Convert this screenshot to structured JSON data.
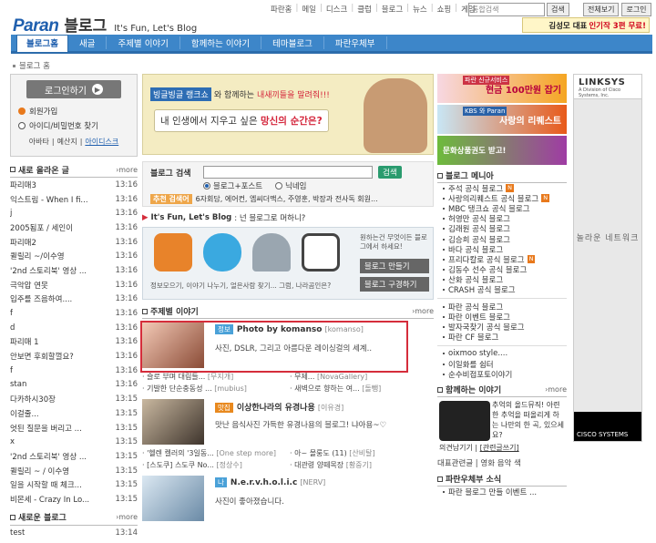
{
  "top_links": [
    "파란홈",
    "메일",
    "디스크",
    "클럽",
    "블로그",
    "뉴스",
    "쇼핑",
    "게임"
  ],
  "search_placeholder": "통합검색",
  "search_button": "검색",
  "util_links": [
    "전체보기",
    "로그인"
  ],
  "logo": {
    "brand": "Paran",
    "title": "블로그",
    "slogan": "It's Fun, Let's Blog"
  },
  "top_banner": {
    "text": "김성모 대표",
    "highlight": "인기작 3편 무료!"
  },
  "main_nav": [
    {
      "label": "블로그홈",
      "active": true
    },
    {
      "label": "새글"
    },
    {
      "label": "주제별 이야기"
    },
    {
      "label": "함께하는 이야기"
    },
    {
      "label": "테마블로그"
    },
    {
      "label": "파란우체부"
    }
  ],
  "breadcrumb": "블로그 홈",
  "login": {
    "button": "로그인하기",
    "join": "회원가입",
    "find": "아이디/비밀번호 찾기",
    "bottom_a": "아바타",
    "bottom_b": "예산지",
    "bottom_c": "아이디스크"
  },
  "new_posts": {
    "title": "새로 올라온 글",
    "more": "more",
    "items": [
      [
        "파리매3",
        "13:16"
      ],
      [
        "익스트림 - When I fi...",
        "13:16"
      ],
      [
        "j",
        "13:16"
      ],
      [
        "2005됨포 / 세인이",
        "13:16"
      ],
      [
        "파리매2",
        "13:16"
      ],
      [
        "퀼릴리 ~/이수영",
        "13:16"
      ],
      [
        "'2nd 스토리북' 영상 ...",
        "13:16"
      ],
      [
        "극악압 연못",
        "13:16"
      ],
      [
        "입주를 즈음하여....",
        "13:16"
      ],
      [
        "f",
        "13:16"
      ],
      [
        "d",
        "13:16"
      ],
      [
        "파리매 1",
        "13:16"
      ],
      [
        "안보면 후회할껄요?",
        "13:16"
      ],
      [
        "f",
        "13:16"
      ],
      [
        "stan",
        "13:16"
      ],
      [
        "다카하시30장",
        "13:15"
      ],
      [
        "이걸줄...",
        "13:15"
      ],
      [
        "엇된 질문을 버리고 ...",
        "13:15"
      ],
      [
        "x",
        "13:15"
      ],
      [
        "'2nd 스토리북' 영상 ...",
        "13:15"
      ],
      [
        "퀼릴리 ~ / 이수영",
        "13:15"
      ],
      [
        "일을 시작할 때 체크...",
        "13:15"
      ],
      [
        "비몬세 - Crazy In Lo...",
        "13:15"
      ]
    ]
  },
  "new_blogs": {
    "title": "새로운 블로그",
    "more": "more",
    "items": [
      [
        "test",
        "13:14"
      ]
    ]
  },
  "ad_mid": {
    "tag": "빙글빙글 랭크쇼",
    "mid": "와 함께하는",
    "red": "내새끼들을 말려줘!!!",
    "line2_a": "내 인생에서 지우고 싶은 ",
    "line2_b": "망신의 순간은?"
  },
  "blog_search": {
    "label": "블로그 검색",
    "button": "검색",
    "opt1": "블로그+포스트",
    "opt2": "닉네임",
    "rec_tag": "추천 검색어",
    "rec_text": "6자회담, 에어컨, 엠씨더맥스, 주영훈, 박장과 전사독 회원..."
  },
  "ifun": {
    "bold": "It's Fun, Let's Blog",
    "rest": ": 넌 블로그로 머하니?"
  },
  "promo": {
    "caption": "정보모으기, 이야기 나누기, 얼은사람 찾기... 그럼, 나라곰인은?",
    "side": "원하는건 무엇이든 블로그에서 하세요!",
    "btn1": "블로그 만들기",
    "btn2": "블로그 구경하기"
  },
  "theme": {
    "title": "주제별 이야기",
    "more": "more",
    "feats": [
      {
        "badge": "정보",
        "title": "Photo by komanso",
        "sub": "[komanso]",
        "desc": "사진, DSLR, 그리고 아름다운 레이싱걸의 세계.."
      },
      {
        "badge": "맛집",
        "title": "이상한나라의 유경나용",
        "sub": "[이유경]",
        "desc": "맛난 음식사진 가득한 유경나용의 블로그! 냐아용~♡"
      },
      {
        "badge": "나",
        "title": "N.e.r.v.h.o.l.i.c",
        "sub": "[NERV]",
        "desc": "사진이 좋아졌습니다."
      }
    ],
    "links1": [
      [
        "· 슬로 부며 대림들...",
        "[무지개]"
      ],
      [
        "· 무제...",
        "[NovaGallery]"
      ],
      [
        "· 기발한 단순충동성 ...",
        "[mubius]"
      ],
      [
        "· 새벽으로 향하는 여...",
        "[돌뺑]"
      ]
    ],
    "links2": [
      [
        "· '헬렌 켈러의 '3일동...",
        "[One step more]"
      ],
      [
        "· 아~ 몰룽도 (11)",
        "[산비탈]"
      ],
      [
        "· [스도쿠] 스도쿠 No...",
        "[정상수]"
      ],
      [
        "· 대관령 양떼목장",
        "[황중기]"
      ]
    ]
  },
  "right_ads": [
    {
      "small": "파란 신규서비스",
      "text": "현금 100만원 잡기"
    },
    {
      "small": "KBS 와 Paran",
      "text": "사랑의 리퀘스트"
    },
    {
      "small": "랭크 참여하고",
      "text": "문화상품권도 받고!"
    }
  ],
  "blog_menu": {
    "title": "블로그 메니아",
    "items": [
      {
        "t": "주석 공식 블로그",
        "n": true
      },
      {
        "t": "사랑의리퀘스트 공식 블로그",
        "n": true
      },
      {
        "t": "MBC 탱크쇼 공식 블로그"
      },
      {
        "t": "허영만 공식 블로그"
      },
      {
        "t": "김래원 공식 블로그"
      },
      {
        "t": "김승희 공식 블로그"
      },
      {
        "t": "바다 공식 블로그"
      },
      {
        "t": "프리다칼로 공식 블로그",
        "n": true
      },
      {
        "t": "김동수 선수 공식 블로그"
      },
      {
        "t": "산화 공식 블로그"
      },
      {
        "t": "CRASH 공식 블로그"
      }
    ],
    "items2": [
      "파란 공식 블로그",
      "파란 이벤트 블로그",
      "발자국찾기 공식 블로그",
      "파란 CF 블로그"
    ],
    "items3": [
      "oixmoo style....",
      "이일화를 쉼터",
      "순수비접포토이야기"
    ]
  },
  "together": {
    "title": "함께하는 이야기",
    "more": "more",
    "text": "추억의 올드뮤직! 아련한 추억을 떠올리게 하는 나만의 한 곡, 있으세요?",
    "opinion": "의견남기기",
    "opinion2": "[관련글쓰기]",
    "links": "대표관련글 | 영화 음악 색"
  },
  "mail": {
    "title": "파란우체부 소식",
    "item": "파란 블로그 만들 이벤트 ..."
  },
  "side_ad": {
    "brand": "LINKSYS",
    "sub": "A Division of Cisco Systems, Inc.",
    "tagline": "놀라운 네트워크",
    "cisco": "CISCO SYSTEMS"
  },
  "colors": {
    "brand_blue": "#3d86c9",
    "highlight_red": "#d52d3b"
  }
}
